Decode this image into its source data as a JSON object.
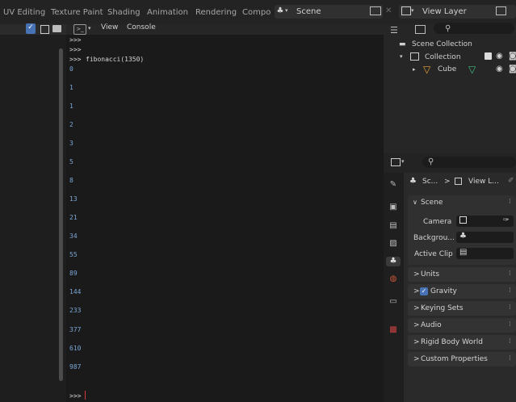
{
  "workspace_tabs": [
    "UV Editing",
    "Texture Paint",
    "Shading",
    "Animation",
    "Rendering",
    "Compo"
  ],
  "scene_selector": {
    "value": "Scene"
  },
  "view_layer_selector": {
    "value": "View Layer"
  },
  "console": {
    "menus": [
      "View",
      "Console"
    ],
    "prompt": ">>>",
    "command": "fibonacci(1350)",
    "outputs": [
      "0",
      "1",
      "1",
      "2",
      "3",
      "5",
      "8",
      "13",
      "21",
      "34",
      "55",
      "89",
      "144",
      "233",
      "377",
      "610",
      "987"
    ]
  },
  "outliner": {
    "scene_collection": "Scene Collection",
    "collection": "Collection",
    "object": "Cube"
  },
  "properties": {
    "breadcrumb": {
      "scene": "Sc...",
      "view_layer": "View L..."
    },
    "scene_panel": "Scene",
    "fields": {
      "camera": "Camera",
      "background": "Backgrou...",
      "active_clip": "Active Clip"
    },
    "panels": [
      "Units",
      "Gravity",
      "Keying Sets",
      "Audio",
      "Rigid Body World",
      "Custom Properties"
    ],
    "gravity_enabled": true
  },
  "colors": {
    "accent": "#4772b3",
    "output_text": "#7aa7d6",
    "cursor": "#d23a3a",
    "cube_icon": "#e8a33c"
  }
}
